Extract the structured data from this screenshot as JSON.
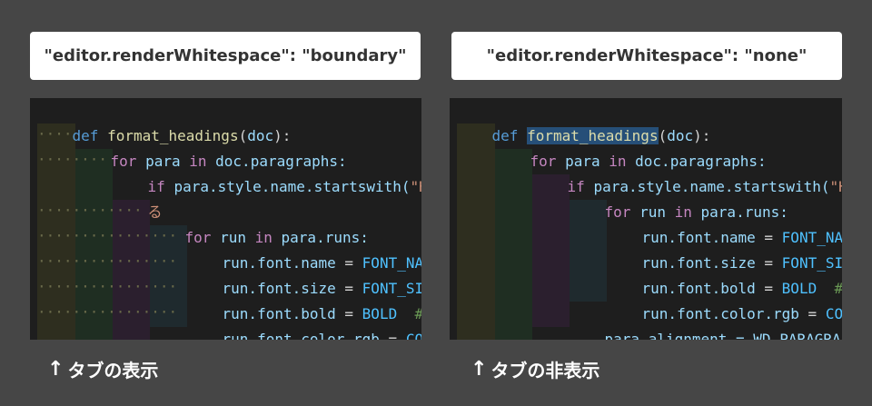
{
  "labels": {
    "left": "\"editor.renderWhitespace\": \"boundary\"",
    "right": "\"editor.renderWhitespace\": \"none\""
  },
  "captions": {
    "arrow": "↑",
    "left": "タブの表示",
    "right": "タブの非表示"
  },
  "code": {
    "def_kw": "def",
    "fn_name": "format_headings",
    "open_paren": "(",
    "param": "doc",
    "close_colon": "):",
    "for_kw": "for",
    "para": "para",
    "in_kw": "in",
    "doc_paragraphs": "doc.paragraphs:",
    "if_kw": "if",
    "style_chain": "para.style.name.startswith(",
    "str_left": "\"Hea",
    "wrap_char": "る",
    "run": "run",
    "para_runs": "para.runs:",
    "font_name": "run.font.name",
    "font_size": "run.font.size",
    "font_bold": "run.font.bold",
    "font_color": "run.font.color.rgb",
    "eq": " = ",
    "const_name": "FONT_NAME",
    "const_size": "FONT_SIZE",
    "const_bold": "BOLD",
    "comment_left": "# 太",
    "const_color_left": "COLOR",
    "const_color_right": "COLOR",
    "para_align": "para.alignment = WD_PARAGRAPH_",
    "comment_right": "# 太"
  },
  "colors": {
    "background": "#464646",
    "editor_bg": "#1e1e1e",
    "guide_yellow": "#2e2e1f",
    "guide_green": "#1f2e22",
    "guide_purple": "#2b1f2e",
    "guide_teal": "#1f2a2e"
  }
}
